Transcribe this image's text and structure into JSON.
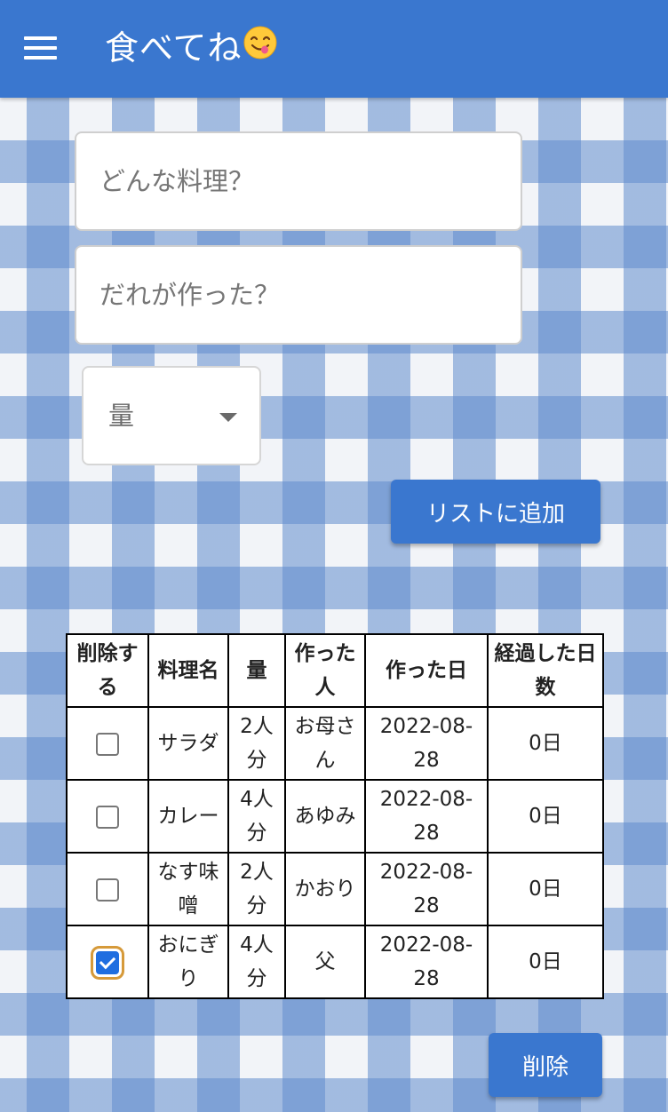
{
  "header": {
    "title": "食べてね",
    "emoji": "yummy-face-icon"
  },
  "form": {
    "dish_placeholder": "どんな料理？",
    "maker_placeholder": "だれが作った？",
    "quantity_select": "量",
    "add_button": "リストに追加"
  },
  "table": {
    "headers": [
      "削除する",
      "料理名",
      "量",
      "作った人",
      "作った日",
      "経過した日数"
    ],
    "rows": [
      {
        "checked": false,
        "dish": "サラダ",
        "amount": "2人分",
        "maker": "お母さん",
        "date": "2022-08-28",
        "days": "0日"
      },
      {
        "checked": false,
        "dish": "カレー",
        "amount": "4人分",
        "maker": "あゆみ",
        "date": "2022-08-28",
        "days": "0日"
      },
      {
        "checked": false,
        "dish": "なす味噌",
        "amount": "2人分",
        "maker": "かおり",
        "date": "2022-08-28",
        "days": "0日"
      },
      {
        "checked": true,
        "dish": "おにぎり",
        "amount": "4人分",
        "maker": "父",
        "date": "2022-08-28",
        "days": "0日"
      }
    ]
  },
  "delete_button": "削除",
  "colors": {
    "primary": "#3a77cf",
    "checkbox_checked": "#1f6ee0",
    "focus_ring": "#d69a3a"
  }
}
